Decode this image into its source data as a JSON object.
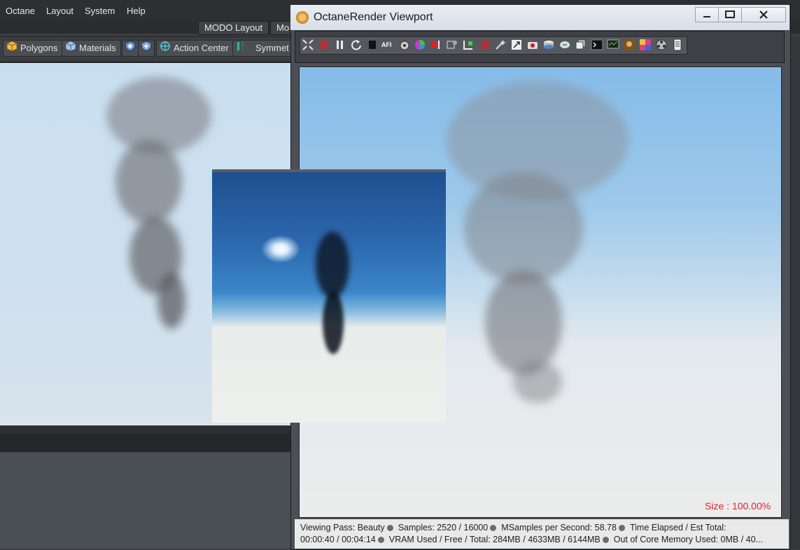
{
  "menu": {
    "items": [
      "Octane",
      "Layout",
      "System",
      "Help"
    ]
  },
  "layout_tabs": [
    "MODO Layout",
    "Mo"
  ],
  "toolbar": {
    "polygons_label": "Polygons",
    "materials_label": "Materials",
    "action_center_label": "Action Center",
    "symmetry_label": "Symmet"
  },
  "octane": {
    "title": "OctaneRender Viewport",
    "toolbar_icon_ai": "AFI",
    "size_label": "Size : 100.00%",
    "status": {
      "viewing_pass": "Viewing Pass: Beauty",
      "samples": "Samples: 2520  / 16000",
      "msamples": "MSamples per Second: 58.78",
      "time": "Time Elapsed / Est Total:",
      "time_value": "00:00:40 / 00:04:14",
      "vram": "VRAM Used / Free / Total: 284MB / 4633MB / 6144MB",
      "ooc": "Out of Core Memory Used: 0MB / 40..."
    }
  },
  "colors": {
    "accent": "#e0232b",
    "window_title_bg": "#dfe5ec",
    "sky_top": "#86bce8"
  }
}
